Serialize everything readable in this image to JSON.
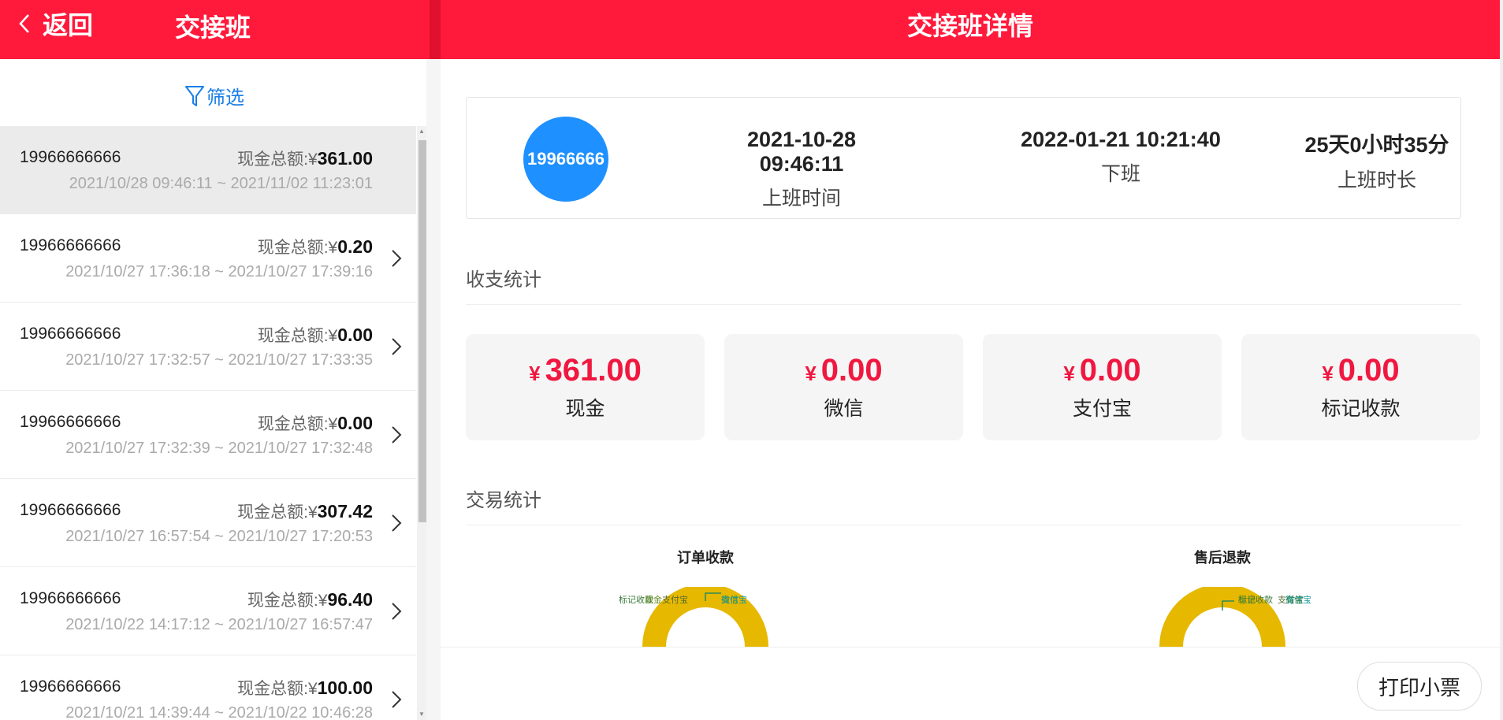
{
  "left_header": {
    "back_label": "返回",
    "title": "交接班"
  },
  "right_header": {
    "title": "交接班详情"
  },
  "filter": {
    "label": "筛选"
  },
  "shifts": [
    {
      "phone": "19966666666",
      "amount_label": "现金总额:",
      "currency": "¥",
      "amount": "361.00",
      "range": "2021/10/28 09:46:11 ~ 2021/11/02 11:23:01",
      "selected": true
    },
    {
      "phone": "19966666666",
      "amount_label": "现金总额:",
      "currency": "¥",
      "amount": "0.20",
      "range": "2021/10/27 17:36:18 ~ 2021/10/27 17:39:16",
      "selected": false
    },
    {
      "phone": "19966666666",
      "amount_label": "现金总额:",
      "currency": "¥",
      "amount": "0.00",
      "range": "2021/10/27 17:32:57 ~ 2021/10/27 17:33:35",
      "selected": false
    },
    {
      "phone": "19966666666",
      "amount_label": "现金总额:",
      "currency": "¥",
      "amount": "0.00",
      "range": "2021/10/27 17:32:39 ~ 2021/10/27 17:32:48",
      "selected": false
    },
    {
      "phone": "19966666666",
      "amount_label": "现金总额:",
      "currency": "¥",
      "amount": "307.42",
      "range": "2021/10/27 16:57:54 ~ 2021/10/27 17:20:53",
      "selected": false
    },
    {
      "phone": "19966666666",
      "amount_label": "现金总额:",
      "currency": "¥",
      "amount": "96.40",
      "range": "2021/10/22 14:17:12 ~ 2021/10/27 16:57:47",
      "selected": false
    },
    {
      "phone": "19966666666",
      "amount_label": "现金总额:",
      "currency": "¥",
      "amount": "100.00",
      "range": "2021/10/21 14:39:44 ~ 2021/10/22 10:46:28",
      "selected": false
    }
  ],
  "detail": {
    "avatar_text": "19966666",
    "start_time": "2021-10-28 09:46:11",
    "start_label": "上班时间",
    "end_time": "2022-01-21 10:21:40",
    "end_label": "下班",
    "duration": "25天0小时35分",
    "duration_label": "上班时长"
  },
  "income_section": {
    "title": "收支统计"
  },
  "stat_cards": [
    {
      "currency": "¥",
      "value": "361.00",
      "label": "现金"
    },
    {
      "currency": "¥",
      "value": "0.00",
      "label": "微信"
    },
    {
      "currency": "¥",
      "value": "0.00",
      "label": "支付宝"
    },
    {
      "currency": "¥",
      "value": "0.00",
      "label": "标记收款"
    }
  ],
  "trade_section": {
    "title": "交易统计"
  },
  "colors": {
    "brand_red": "#ff1a3c",
    "amount_red": "#f01840",
    "avatar_blue": "#1e90ff",
    "donut_yellow": "#e6b800",
    "link_blue": "#1a7fe6"
  },
  "chart_data": [
    {
      "type": "pie",
      "title": "订单收款",
      "legend_labels": [
        "标记收款",
        "现金",
        "支付宝",
        "微信",
        "支付宝"
      ]
    },
    {
      "type": "pie",
      "title": "售后退款",
      "legend_labels": [
        "现金",
        "标记收款",
        "支付宝",
        "微信",
        "支付宝"
      ]
    }
  ],
  "print_button": {
    "label": "打印小票"
  }
}
